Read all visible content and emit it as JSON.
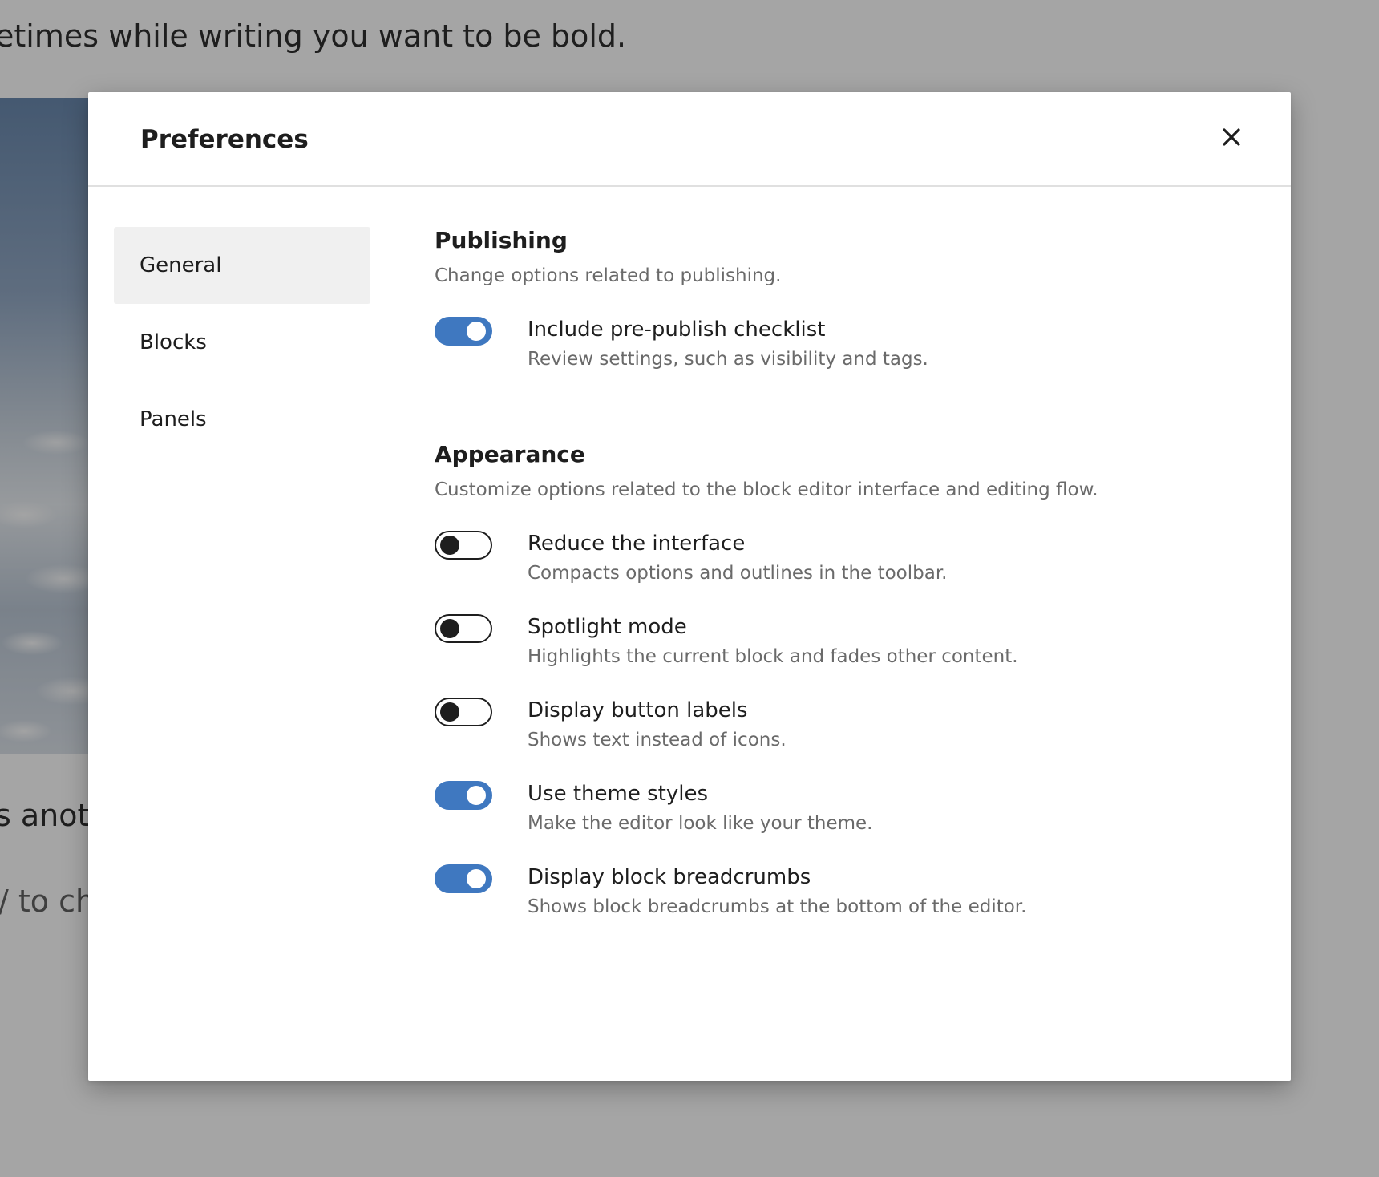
{
  "background": {
    "text_line_1": "etimes while writing you want to be bold.",
    "text_line_2": "s anoth",
    "text_line_3": "/ to ch"
  },
  "modal": {
    "title": "Preferences",
    "close_icon": "close-icon"
  },
  "sidebar": {
    "items": [
      {
        "label": "General",
        "active": true
      },
      {
        "label": "Blocks",
        "active": false
      },
      {
        "label": "Panels",
        "active": false
      }
    ]
  },
  "publishing": {
    "title": "Publishing",
    "description": "Change options related to publishing.",
    "options": [
      {
        "label": "Include pre-publish checklist",
        "help": "Review settings, such as visibility and tags.",
        "enabled": true
      }
    ]
  },
  "appearance": {
    "title": "Appearance",
    "description": "Customize options related to the block editor interface and editing flow.",
    "options": [
      {
        "label": "Reduce the interface",
        "help": "Compacts options and outlines in the toolbar.",
        "enabled": false
      },
      {
        "label": "Spotlight mode",
        "help": "Highlights the current block and fades other content.",
        "enabled": false
      },
      {
        "label": "Display button labels",
        "help": "Shows text instead of icons.",
        "enabled": false
      },
      {
        "label": "Use theme styles",
        "help": "Make the editor look like your theme.",
        "enabled": true
      },
      {
        "label": "Display block breadcrumbs",
        "help": "Shows block breadcrumbs at the bottom of the editor.",
        "enabled": true
      }
    ]
  },
  "colors": {
    "accent": "#3f78c0",
    "overlay": "#1e1e1e",
    "text": "#1e1e1e",
    "muted_text": "#6a6a6a",
    "active_nav_bg": "#f0f0f0"
  }
}
